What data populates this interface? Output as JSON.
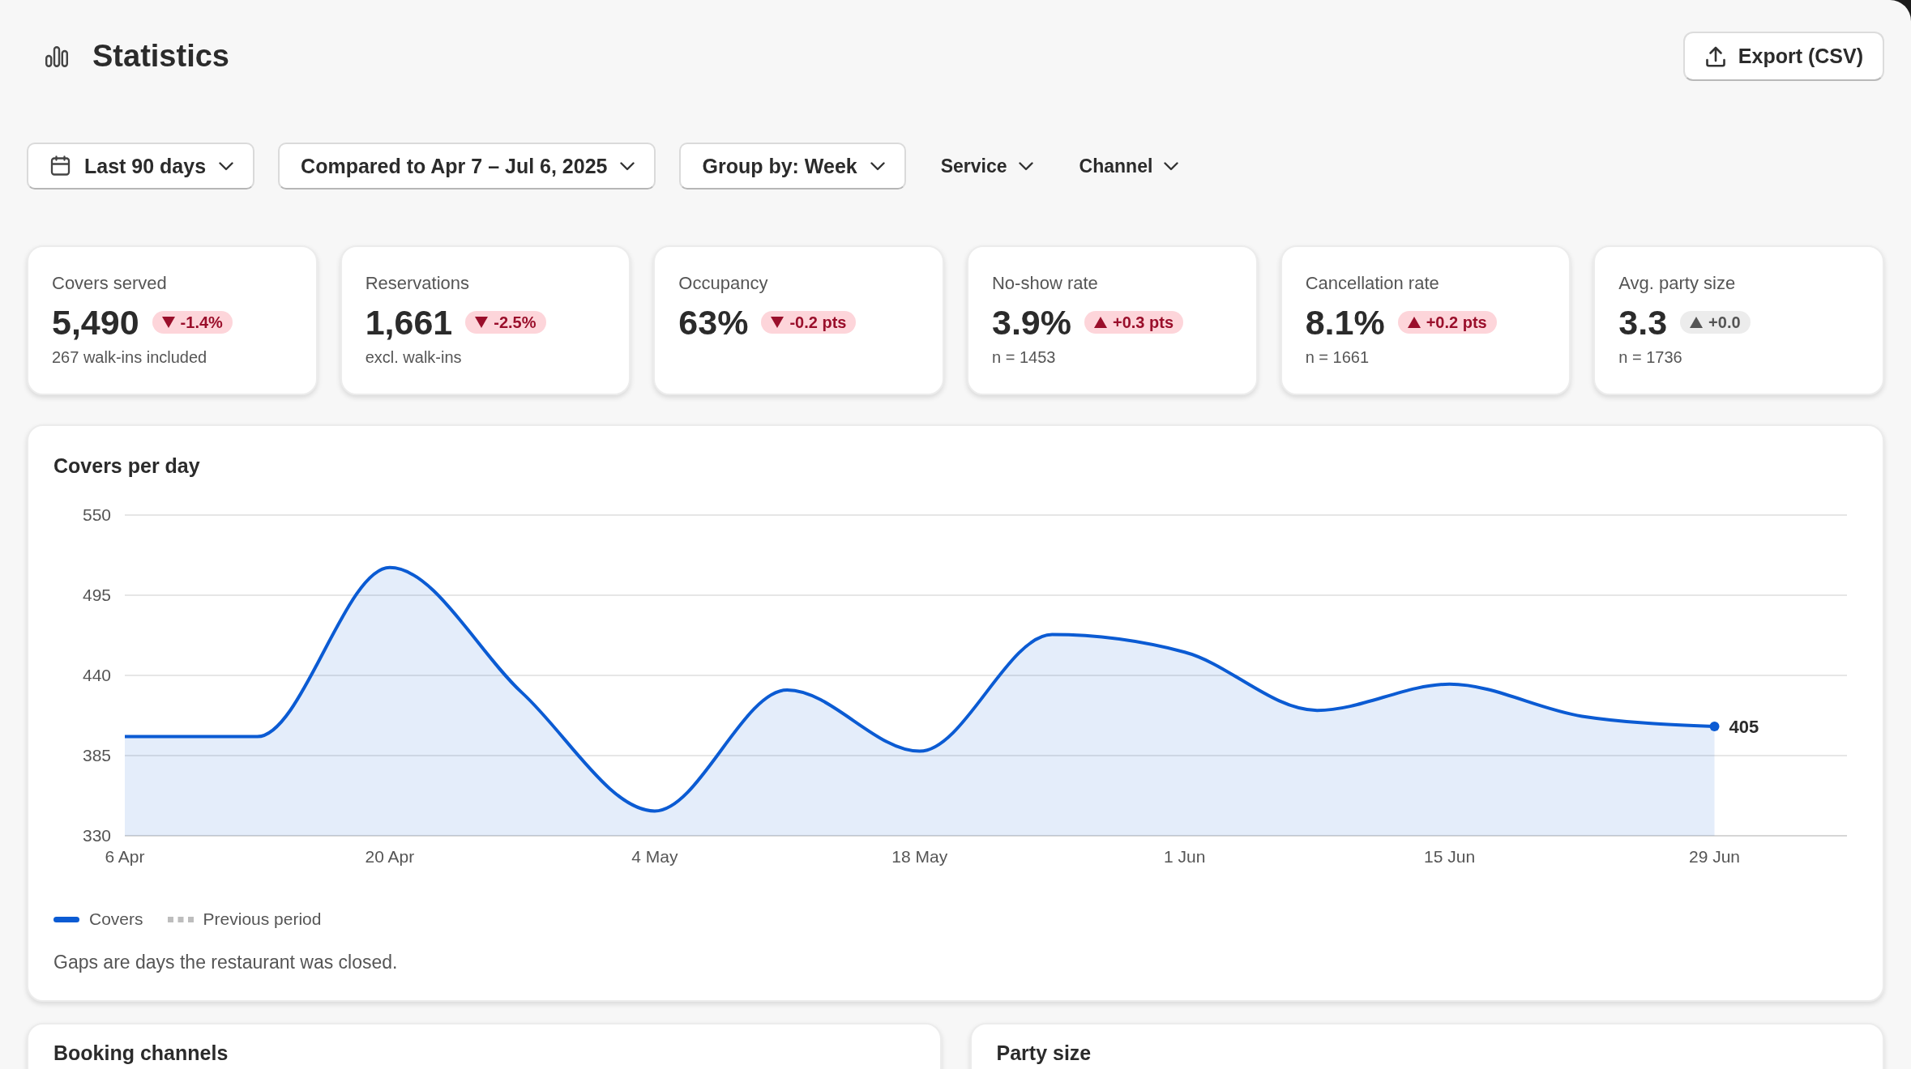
{
  "header": {
    "title": "Statistics",
    "export_label": "Export (CSV)"
  },
  "filters": [
    {
      "kind": "date",
      "label": "Last 90 days"
    },
    {
      "kind": "select",
      "label": "Compared to Apr 7 – Jul 6, 2025"
    },
    {
      "kind": "select",
      "label": "Group by: Week"
    },
    {
      "kind": "menu",
      "label": "Service"
    },
    {
      "kind": "menu",
      "label": "Channel"
    }
  ],
  "kpis": [
    {
      "label": "Covers served",
      "value": "5,490",
      "change": "-1.4%",
      "increase": false,
      "unfavorable": true,
      "note": "267 walk-ins included"
    },
    {
      "label": "Reservations",
      "value": "1,661",
      "change": "-2.5%",
      "increase": false,
      "unfavorable": true,
      "note": "excl. walk-ins"
    },
    {
      "label": "Occupancy",
      "value": "63%",
      "change": "-0.2 pts",
      "increase": false,
      "unfavorable": true
    },
    {
      "label": "No-show rate",
      "value": "3.9%",
      "change": "+0.3 pts",
      "increase": true,
      "unfavorable": true,
      "note": "n = 1453"
    },
    {
      "label": "Cancellation rate",
      "value": "8.1%",
      "change": "+0.2 pts",
      "increase": true,
      "unfavorable": true,
      "note": "n = 1661"
    },
    {
      "label": "Avg. party size",
      "value": "3.3",
      "change": "+0.0",
      "increase": true,
      "unfavorable": false,
      "note": "n = 1736"
    }
  ],
  "covers_card": {
    "title": "Covers per day",
    "chart_data": {
      "type": "area",
      "categories": [
        "6 Apr",
        null,
        "20 Apr",
        null,
        "4 May",
        null,
        "18 May",
        null,
        "1 Jun",
        null,
        "15 Jun",
        null,
        "29 Jun"
      ],
      "series": [
        {
          "name": "Covers",
          "color": "#0b5bd3",
          "values": [
            398,
            398,
            514,
            428,
            347,
            430,
            388,
            468,
            456,
            416,
            434,
            412,
            405
          ]
        }
      ],
      "ylim": [
        330,
        550
      ],
      "yticks": [
        330,
        385,
        440,
        495,
        550
      ],
      "grid": true,
      "annotations": [
        {
          "x": "29 Jun",
          "y": 405,
          "text": "405"
        }
      ]
    },
    "legend_extra": [
      {
        "label": "Previous period",
        "kind": "dotted",
        "color": "#bdbdbd"
      }
    ],
    "note": "Gaps are days the restaurant was closed."
  },
  "bottom_cards": [
    {
      "title": "Booking channels"
    },
    {
      "title": "Party size"
    }
  ]
}
